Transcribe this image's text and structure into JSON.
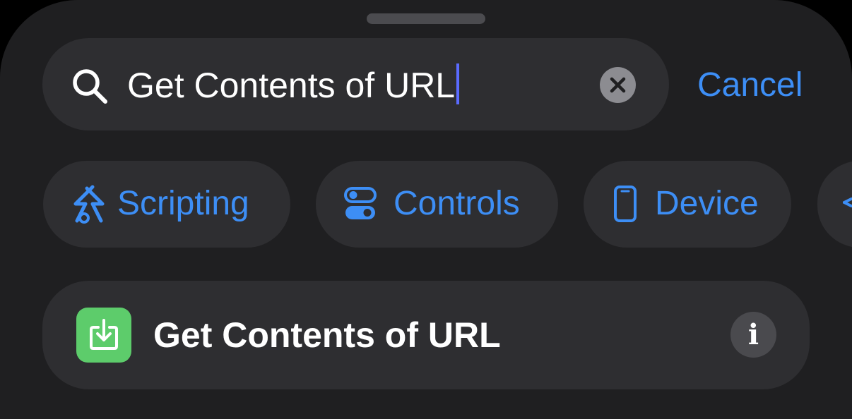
{
  "search": {
    "query": "Get Contents of URL",
    "icon": "search-icon",
    "clear_icon": "clear-icon"
  },
  "cancel_label": "Cancel",
  "categories": [
    {
      "label": "Scripting",
      "icon": "scripting-icon"
    },
    {
      "label": "Controls",
      "icon": "controls-toggle-icon"
    },
    {
      "label": "Device",
      "icon": "phone-icon"
    }
  ],
  "result": {
    "label": "Get Contents of URL",
    "icon": "download-tray-icon",
    "info_icon": "info-icon",
    "info_glyph": "i"
  },
  "colors": {
    "accent": "#3d8ef5",
    "background": "#1f1f21",
    "field": "#2e2e31",
    "action_icon": "#5dcc6b"
  }
}
